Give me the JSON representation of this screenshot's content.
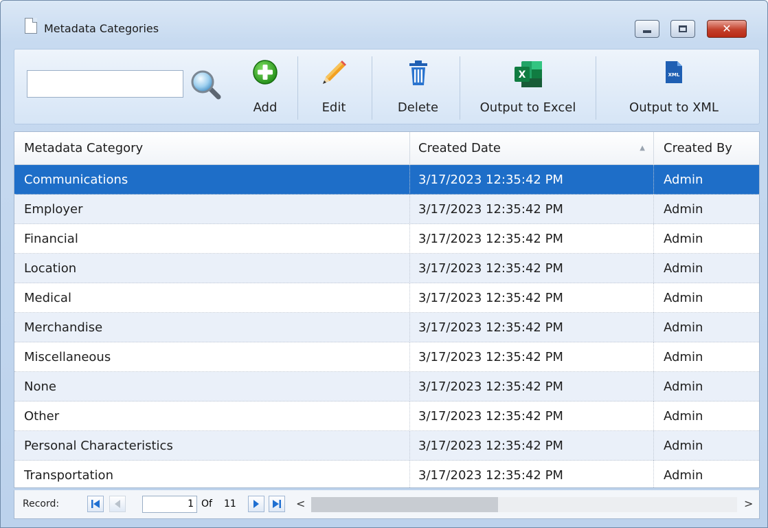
{
  "window": {
    "title": "Metadata Categories",
    "close_glyph": "✕"
  },
  "toolbar": {
    "search_value": "",
    "buttons": [
      {
        "label": "Add",
        "icon": "add-plus-circle-icon"
      },
      {
        "label": "Edit",
        "icon": "pencil-icon"
      },
      {
        "label": "Delete",
        "icon": "trash-icon"
      },
      {
        "label": "Output to Excel",
        "icon": "excel-icon"
      },
      {
        "label": "Output to XML",
        "icon": "xml-file-icon"
      }
    ],
    "xml_icon_text": "XML",
    "excel_icon_text": "X"
  },
  "grid": {
    "columns": [
      "Metadata Category",
      "Created Date",
      "Created By"
    ],
    "sort_indicator": "▲",
    "rows": [
      [
        "Communications",
        "3/17/2023 12:35:42 PM",
        "Admin"
      ],
      [
        "Employer",
        "3/17/2023 12:35:42 PM",
        "Admin"
      ],
      [
        "Financial",
        "3/17/2023 12:35:42 PM",
        "Admin"
      ],
      [
        "Location",
        "3/17/2023 12:35:42 PM",
        "Admin"
      ],
      [
        "Medical",
        "3/17/2023 12:35:42 PM",
        "Admin"
      ],
      [
        "Merchandise",
        "3/17/2023 12:35:42 PM",
        "Admin"
      ],
      [
        "Miscellaneous",
        "3/17/2023 12:35:42 PM",
        "Admin"
      ],
      [
        "None",
        "3/17/2023 12:35:42 PM",
        "Admin"
      ],
      [
        "Other",
        "3/17/2023 12:35:42 PM",
        "Admin"
      ],
      [
        "Personal Characteristics",
        "3/17/2023 12:35:42 PM",
        "Admin"
      ],
      [
        "Transportation",
        "3/17/2023 12:35:42 PM",
        "Admin"
      ]
    ],
    "selected_index": 0
  },
  "navigator": {
    "record_label": "Record:",
    "position": "1",
    "of_label": "Of",
    "total": "11",
    "scroll_left": "<",
    "scroll_right": ">"
  },
  "colors": {
    "selection": "#1e6ec8",
    "alt_row": "#eaf0f9",
    "nav_blue": "#1f6fd1"
  }
}
